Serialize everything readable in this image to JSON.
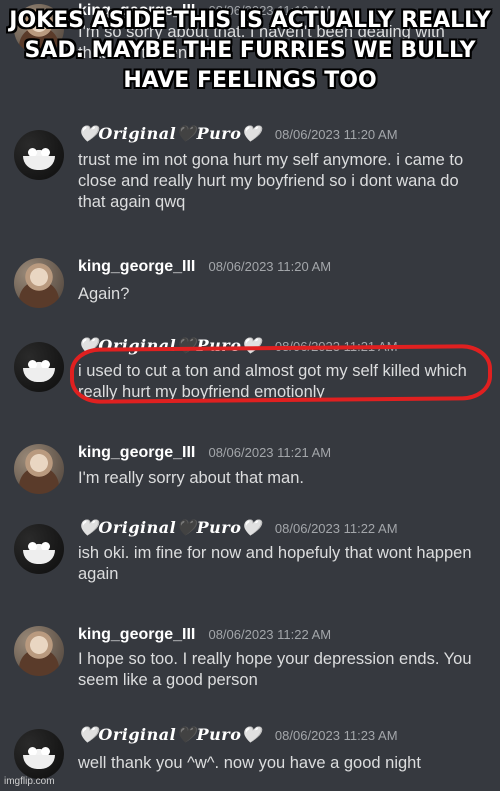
{
  "caption": {
    "text": "JOKES ASIDE THIS IS ACTUALLY REALLY SAD. MAYBE THE FURRIES WE BULLY HAVE FEELINGS TOO"
  },
  "messages": [
    {
      "author": "king_george_III",
      "timestamp": "08/06/2023 11:19 AM",
      "text": "I'm so sorry about that. I haven't been dealing with that... in the end"
    },
    {
      "author": "🤍𝑶𝒓𝒊𝒈𝒊𝒏𝒂𝒍🖤𝑷𝒖𝒓𝒐🤍",
      "timestamp": "08/06/2023 11:20 AM",
      "text": "trust me im not gona hurt my self anymore. i came to close and really hurt my boyfriend so i dont wana do that again qwq"
    },
    {
      "author": "king_george_III",
      "timestamp": "08/06/2023 11:20 AM",
      "text": "Again?"
    },
    {
      "author": "🤍𝑶𝒓𝒊𝒈𝒊𝒏𝒂𝒍🖤𝑷𝒖𝒓𝒐🤍",
      "timestamp": "08/06/2023 11:21 AM",
      "text": "i used to cut a ton and almost got my self killed which really hurt my boyfriend emotionly"
    },
    {
      "author": "king_george_III",
      "timestamp": "08/06/2023 11:21 AM",
      "text": "I'm really sorry about that man."
    },
    {
      "author": "🤍𝑶𝒓𝒊𝒈𝒊𝒏𝒂𝒍🖤𝑷𝒖𝒓𝒐🤍",
      "timestamp": "08/06/2023 11:22 AM",
      "text": "ish oki. im fine for now and hopefuly that wont happen again"
    },
    {
      "author": "king_george_III",
      "timestamp": "08/06/2023 11:22 AM",
      "text": "I hope so too. I really hope your depression ends. You seem like a good person"
    },
    {
      "author": "🤍𝑶𝒓𝒊𝒈𝒊𝒏𝒂𝒍🖤𝑷𝒖𝒓𝒐🤍",
      "timestamp": "08/06/2023 11:23 AM",
      "text": "well thank you ^w^. now you have a good night"
    }
  ],
  "watermark": "imgflip.com",
  "colors": {
    "background": "#36393f",
    "username": "#ffffff",
    "timestamp": "#a3a6aa",
    "message_text": "#dcddde",
    "highlight_circle": "#e02020"
  }
}
